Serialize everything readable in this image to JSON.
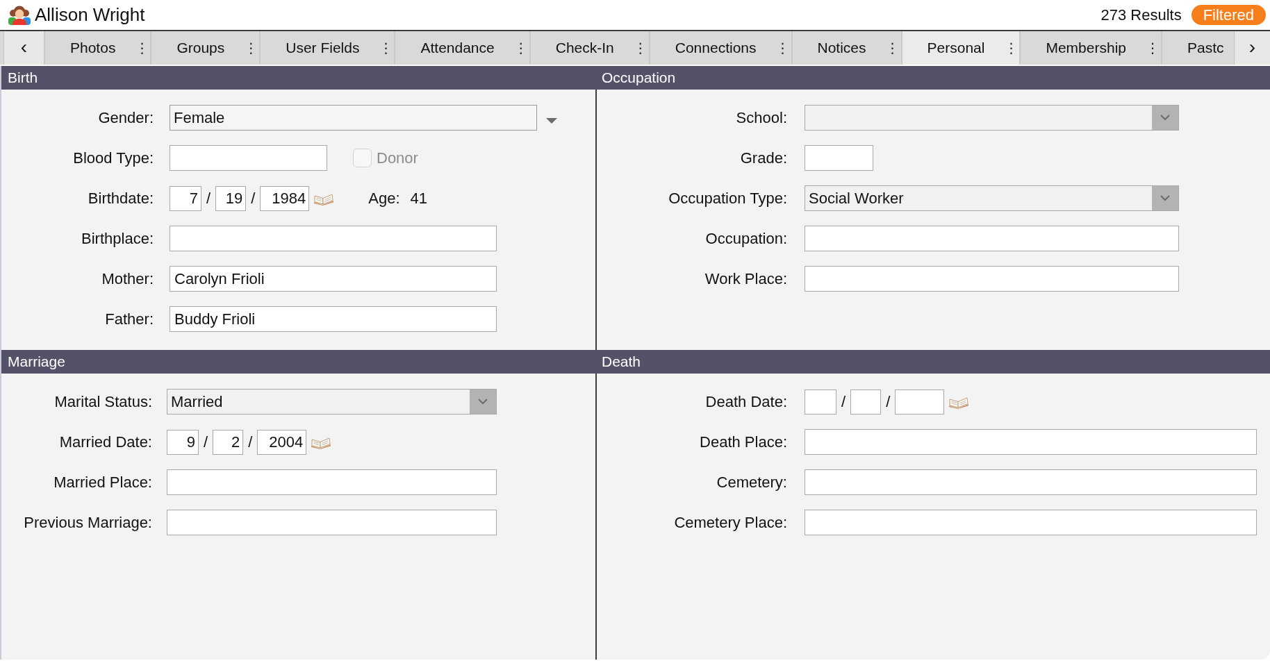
{
  "header": {
    "title": "Allison Wright",
    "results": "273 Results",
    "filter_badge": "Filtered"
  },
  "tabs": {
    "prev": "‹",
    "items": [
      {
        "label": "Photos",
        "menu": "⋮",
        "selected": false
      },
      {
        "label": "Groups",
        "menu": "⋮",
        "selected": false
      },
      {
        "label": "User Fields",
        "menu": "⋮",
        "selected": false
      },
      {
        "label": "Attendance",
        "menu": "⋮",
        "selected": false
      },
      {
        "label": "Check-In",
        "menu": "⋮",
        "selected": false
      },
      {
        "label": "Connections",
        "menu": "⋮",
        "selected": false
      },
      {
        "label": "Notices",
        "menu": "⋮",
        "selected": false
      },
      {
        "label": "Personal",
        "menu": "⋮",
        "selected": true
      },
      {
        "label": "Membership",
        "menu": "⋮",
        "selected": false
      },
      {
        "label": "Pastc",
        "selected": false
      }
    ],
    "next": "›"
  },
  "sections": [
    {
      "title": "Birth",
      "fields": [
        {
          "kind": "popup",
          "label": "Gender:",
          "value": "Female"
        },
        {
          "kind": "text_with_checkbox",
          "label": "Blood Type:",
          "checkbox": {
            "label": "Donor",
            "checked": false,
            "disabled": true
          }
        },
        {
          "kind": "date",
          "label": "Birthdate:",
          "month": "7",
          "day": "19",
          "year": "1984",
          "separators": [
            "/",
            "/"
          ],
          "age": {
            "label": "Age:",
            "value": "41"
          }
        },
        {
          "kind": "text",
          "label": "Birthplace:"
        },
        {
          "kind": "text",
          "label": "Mother:",
          "value": "Carolyn Frioli"
        },
        {
          "kind": "text",
          "label": "Father:",
          "value": "Buddy Frioli"
        }
      ]
    },
    {
      "title": "Occupation",
      "fields": [
        {
          "kind": "combo",
          "label": "School:"
        },
        {
          "kind": "short_text",
          "label": "Grade:"
        },
        {
          "kind": "combo",
          "label": "Occupation Type:",
          "value": "Social Worker"
        },
        {
          "kind": "text",
          "label": "Occupation:"
        },
        {
          "kind": "text",
          "label": "Work Place:"
        }
      ]
    },
    {
      "title": "Marriage",
      "fields": [
        {
          "kind": "combo",
          "label": "Marital Status:",
          "value": "Married"
        },
        {
          "kind": "date",
          "label": "Married Date:",
          "month": "9",
          "day": "2",
          "year": "2004",
          "separators": [
            "/",
            "/"
          ]
        },
        {
          "kind": "text",
          "label": "Married Place:"
        },
        {
          "kind": "text",
          "label": "Previous Marriage:"
        }
      ]
    },
    {
      "title": "Death",
      "fields": [
        {
          "kind": "date",
          "label": "Death Date:",
          "separators": [
            "/",
            "/"
          ]
        },
        {
          "kind": "text",
          "label": "Death Place:"
        },
        {
          "kind": "text",
          "label": "Cemetery:"
        },
        {
          "kind": "text",
          "label": "Cemetery Place:"
        }
      ]
    }
  ]
}
